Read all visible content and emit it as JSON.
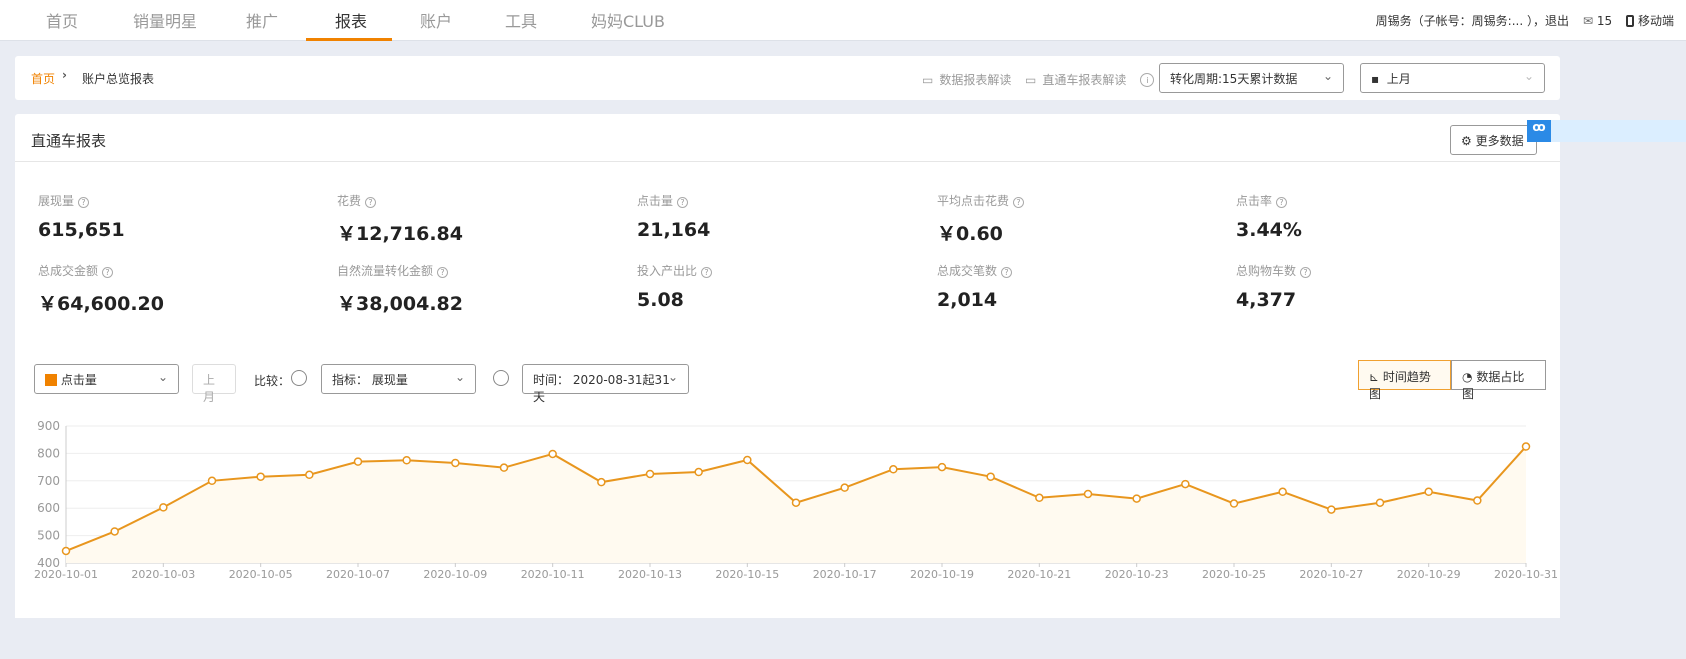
{
  "nav": {
    "items": [
      "首页",
      "销量明星",
      "推广",
      "报表",
      "账户",
      "工具",
      "妈妈CLUB"
    ],
    "active_index": 3,
    "accent": "#f08200"
  },
  "user": {
    "account": "周锡务（子帐号：周锡务:...  ），退出",
    "messages": "15",
    "mobile": "移动端"
  },
  "breadcrumb": {
    "home": "首页",
    "current": "账户总览报表"
  },
  "links": {
    "data_report": "数据报表解读",
    "ztc_report": "直通车报表解读"
  },
  "filters": {
    "cycle": "转化周期:15天累计数据",
    "period": "上月"
  },
  "report": {
    "title": "直通车报表",
    "more_button": "更多数据"
  },
  "metrics": [
    {
      "label": "展现量",
      "value": "615,651"
    },
    {
      "label": "花费",
      "value": "￥12,716.84"
    },
    {
      "label": "点击量",
      "value": "21,164"
    },
    {
      "label": "平均点击花费",
      "value": "￥0.60"
    },
    {
      "label": "点击率",
      "value": "3.44%"
    },
    {
      "label": "总成交金额",
      "value": "￥64,600.20"
    },
    {
      "label": "自然流量转化金额",
      "value": "￥38,004.82"
    },
    {
      "label": "投入产出比",
      "value": "5.08"
    },
    {
      "label": "总成交笔数",
      "value": "2,014"
    },
    {
      "label": "总购物车数",
      "value": "4,377"
    }
  ],
  "chart_controls": {
    "metric": "点击量",
    "last_month": "上月",
    "compare": "比较：",
    "indicator": "指标： 展现量",
    "time": "时间： 2020-08-31起31天",
    "trend_button": "时间趋势图",
    "share_button": "数据占比图"
  },
  "chart_data": {
    "type": "line",
    "x": [
      "2020-10-01",
      "2020-10-02",
      "2020-10-03",
      "2020-10-04",
      "2020-10-05",
      "2020-10-06",
      "2020-10-07",
      "2020-10-08",
      "2020-10-09",
      "2020-10-10",
      "2020-10-11",
      "2020-10-12",
      "2020-10-13",
      "2020-10-14",
      "2020-10-15",
      "2020-10-16",
      "2020-10-17",
      "2020-10-18",
      "2020-10-19",
      "2020-10-20",
      "2020-10-21",
      "2020-10-22",
      "2020-10-23",
      "2020-10-24",
      "2020-10-25",
      "2020-10-26",
      "2020-10-27",
      "2020-10-28",
      "2020-10-29",
      "2020-10-30",
      "2020-10-31"
    ],
    "series": [
      {
        "name": "点击量",
        "values": [
          444,
          515,
          603,
          700,
          715,
          722,
          770,
          775,
          765,
          748,
          798,
          695,
          725,
          732,
          776,
          620,
          675,
          742,
          750,
          715,
          638,
          652,
          635,
          688,
          617,
          660,
          595,
          620,
          660,
          628,
          825
        ],
        "color": "#e8961e"
      }
    ],
    "yticks": [
      400,
      500,
      600,
      700,
      800,
      900
    ],
    "ylim": [
      400,
      900
    ],
    "xtick_every": 2,
    "grid": true
  }
}
